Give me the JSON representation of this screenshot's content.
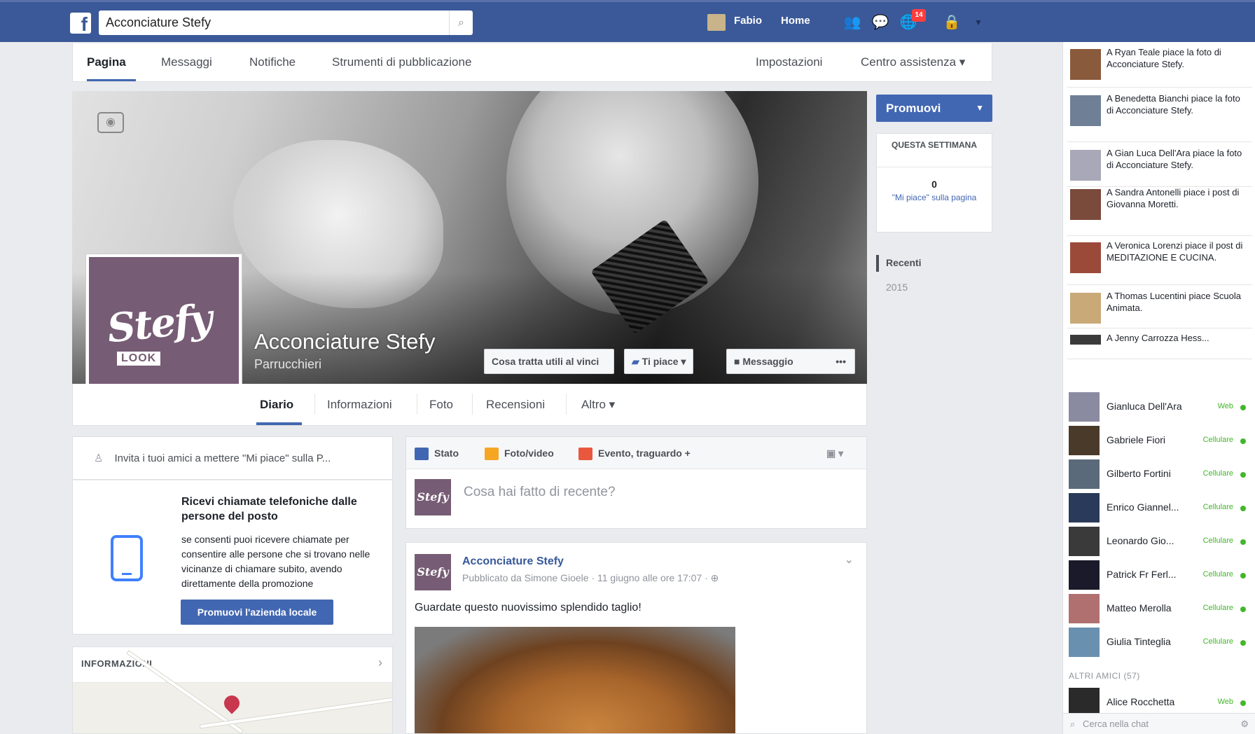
{
  "topbar": {
    "logo": "f",
    "search_value": "Acconciature Stefy",
    "links": [
      "Fabio",
      "Home"
    ],
    "notification_count": "14"
  },
  "page_nav": {
    "items": [
      "Pagina",
      "Messaggi",
      "Notifiche",
      "Strumenti di pubblicazione"
    ],
    "right": [
      "Impostazioni",
      "Centro assistenza ▾"
    ]
  },
  "page": {
    "name": "Acconciature Stefy",
    "category": "Parrucchieri",
    "logo_script": "Stefy",
    "logo_word": "LOOK",
    "cover_buttons": {
      "invite": "Cosa tratta utili al vinci",
      "like": "Ti piace ▾",
      "message": "Messaggio",
      "more": "•••"
    }
  },
  "tabs": [
    "Diario",
    "Informazioni",
    "Foto",
    "Recensioni",
    "Altro ▾"
  ],
  "right_panel": {
    "promote": "Promuovi",
    "week_title": "QUESTA SETTIMANA",
    "week_value": "0",
    "week_label": "\"Mi piace\" sulla pagina",
    "timeline": [
      "Recenti",
      "2015"
    ]
  },
  "invite_bar": "Invita i tuoi amici a mettere \"Mi piace\" sulla P...",
  "call_card": {
    "title": "Ricevi chiamate telefoniche dalle persone del posto",
    "desc": "se consenti puoi ricevere chiamate per consentire alle persone che si trovano nelle vicinanze di chiamare subito, avendo direttamente della promozione",
    "button": "Promuovi l'azienda locale"
  },
  "info_card": {
    "title": "INFORMAZIONI"
  },
  "composer": {
    "tabs": [
      "Stato",
      "Foto/video",
      "Evento, traguardo +"
    ],
    "tab_colors": [
      "#4267b2",
      "#f5a623",
      "#e9573f"
    ],
    "placeholder": "Cosa hai fatto di recente?"
  },
  "post": {
    "author": "Acconciature Stefy",
    "meta": "Pubblicato da Simone Gioele · 11 giugno alle ore 17:07 · ⊕",
    "text": "Guardate questo nuovissimo splendido taglio!"
  },
  "chat": {
    "activity": [
      "A Ryan Teale piace la foto di Acconciature Stefy.",
      "A Benedetta Bianchi piace la foto di Acconciature Stefy.",
      "A Gian Luca Dell'Ara piace la foto di Acconciature Stefy.",
      "A Sandra Antonelli piace i post di Giovanna Moretti.",
      "A Veronica Lorenzi piace il post di MEDITAZIONE E CUCINA.",
      "A Thomas Lucentini piace Scuola Animata.",
      "A Jenny Carrozza Hess..."
    ],
    "contacts": [
      {
        "name": "Gianluca Dell'Ara",
        "status": "Web"
      },
      {
        "name": "Gabriele Fiori",
        "status": "Cellulare"
      },
      {
        "name": "Gilberto Fortini",
        "status": "Cellulare"
      },
      {
        "name": "Enrico Giannel...",
        "status": "Cellulare"
      },
      {
        "name": "Leonardo Gio...",
        "status": "Cellulare"
      },
      {
        "name": "Patrick Fr Ferl...",
        "status": "Cellulare"
      },
      {
        "name": "Matteo Merolla",
        "status": "Cellulare"
      },
      {
        "name": "Giulia Tinteglia",
        "status": "Cellulare"
      },
      {
        "name": "Alice Rocchetta",
        "status": "Web"
      }
    ],
    "others_label": "ALTRI AMICI (57)",
    "search_placeholder": "Cerca nella chat"
  }
}
